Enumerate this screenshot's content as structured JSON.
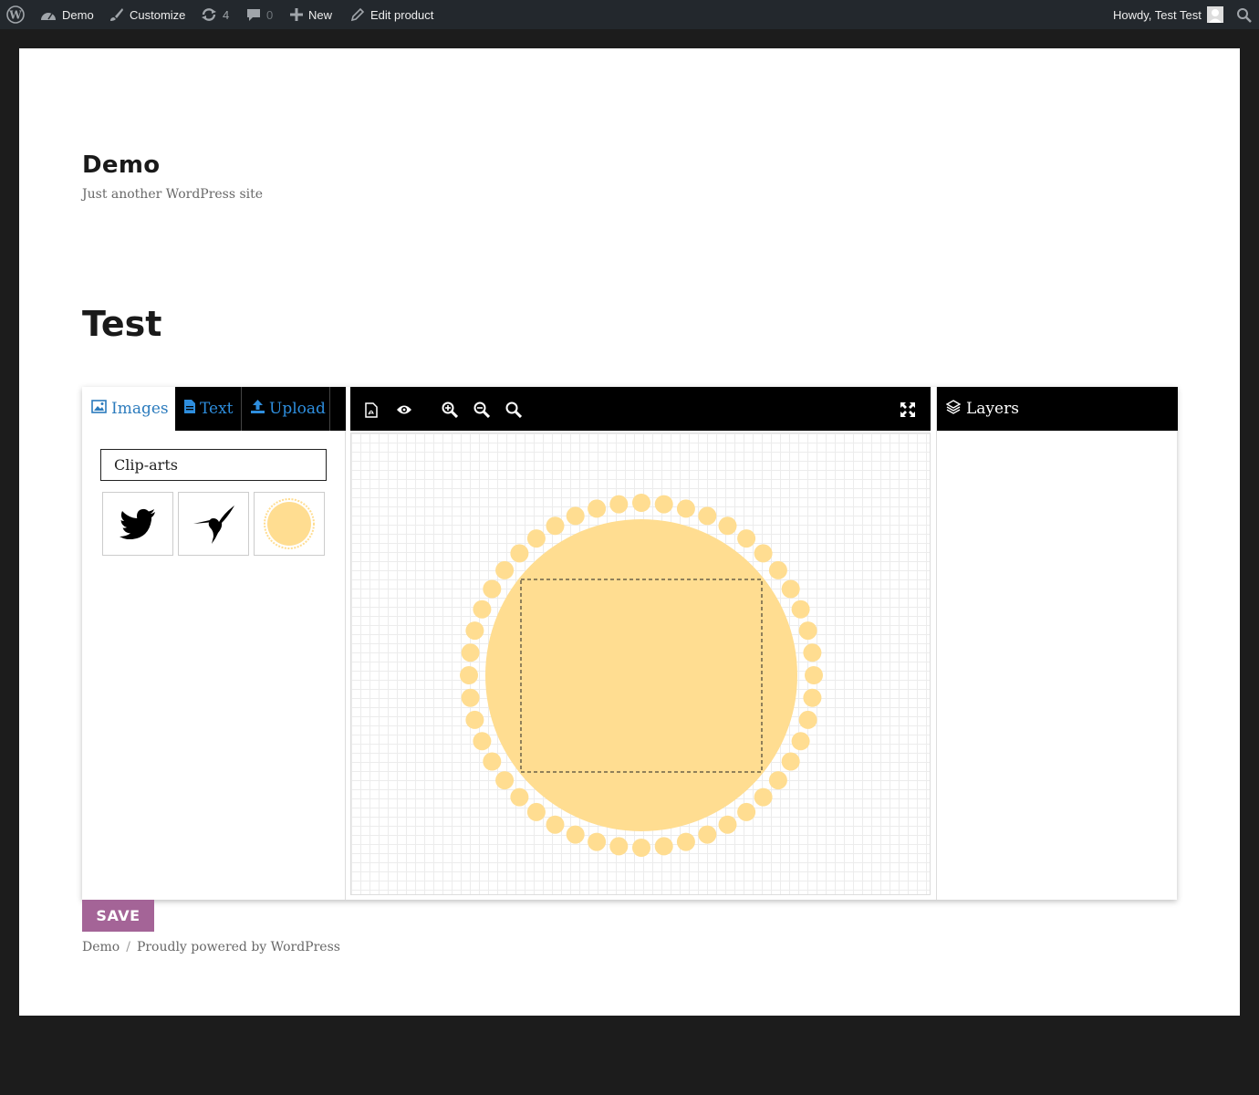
{
  "adminbar": {
    "site_name": "Demo",
    "customize": "Customize",
    "updates_count": "4",
    "comments_count": "0",
    "new": "New",
    "edit_product": "Edit product",
    "howdy": "Howdy, Test Test"
  },
  "site": {
    "title": "Demo",
    "description": "Just another WordPress site"
  },
  "page": {
    "title": "Test"
  },
  "designer": {
    "tabs": [
      {
        "label": "Images",
        "icon": "image-icon"
      },
      {
        "label": "Text",
        "icon": "document-icon"
      },
      {
        "label": "Upload",
        "icon": "upload-icon"
      }
    ],
    "category_select": "Clip-arts",
    "cliparts": [
      "twitter-bird",
      "hummingbird",
      "scalloped-circle"
    ],
    "toolbar": [
      "pdf-icon",
      "eye-icon",
      "zoom-in-icon",
      "zoom-out-icon",
      "zoom-reset-icon",
      "fullscreen-icon"
    ],
    "layers_label": "Layers",
    "product_color": "#ffdd91"
  },
  "actions": {
    "save": "SAVE"
  },
  "footer": {
    "site_link": "Demo",
    "separator": "/",
    "powered": "Proudly powered by WordPress"
  },
  "colors": {
    "accent_tab": "#2e8ede",
    "save_button": "#a46497",
    "admin_bar": "#23282d"
  }
}
